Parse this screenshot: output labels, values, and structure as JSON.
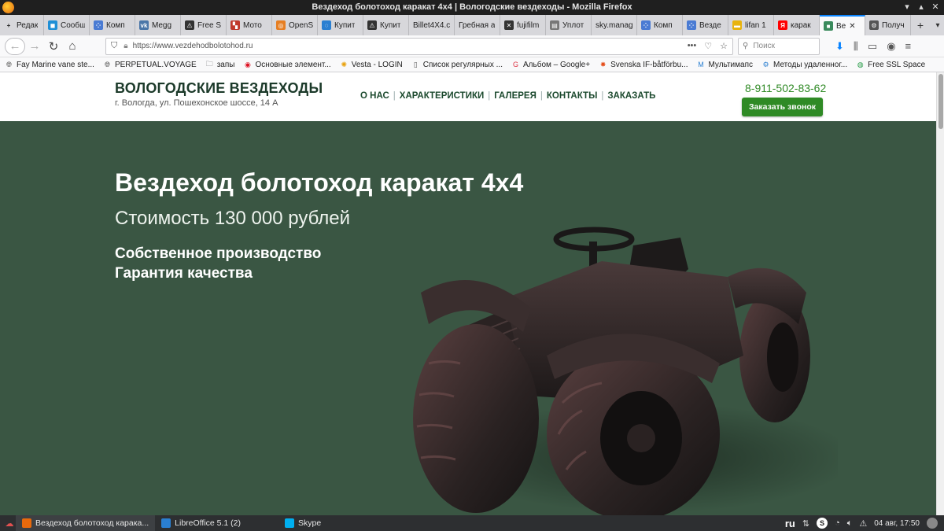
{
  "window": {
    "title": "Вездеход болотоход каракат 4x4 | Вологодские вездеходы - Mozilla Firefox"
  },
  "tabs": [
    {
      "label": "Редак",
      "icon": "plus",
      "color": "#d7d7db"
    },
    {
      "label": "Сообщ",
      "icon": "chat",
      "color": "#1f8fd6"
    },
    {
      "label": "Комп",
      "icon": "dots",
      "color": "#4a7bd3"
    },
    {
      "label": "Megg",
      "icon": "vk",
      "color": "#4a76a8"
    },
    {
      "label": "Free S",
      "icon": "warning",
      "color": "#333333"
    },
    {
      "label": "Мото",
      "icon": "flag",
      "color": "#c0392b"
    },
    {
      "label": "OpenS",
      "icon": "circle",
      "color": "#e67e22"
    },
    {
      "label": "Купит",
      "icon": "swirl",
      "color": "#2a7fd1"
    },
    {
      "label": "Купит",
      "icon": "warning",
      "color": "#333333"
    },
    {
      "label": "Billet4X4.c",
      "icon": "none",
      "color": "#d7d7db"
    },
    {
      "label": "Гребная а",
      "icon": "none",
      "color": "#d7d7db"
    },
    {
      "label": "fujifilm",
      "icon": "x",
      "color": "#333333"
    },
    {
      "label": "Уплот",
      "icon": "doc",
      "color": "#777777"
    },
    {
      "label": "sky.manag",
      "icon": "none",
      "color": "#d7d7db"
    },
    {
      "label": "Комп",
      "icon": "dots",
      "color": "#4a7bd3"
    },
    {
      "label": "Везде",
      "icon": "dots",
      "color": "#4a7bd3"
    },
    {
      "label": "lifan 1",
      "icon": "bars",
      "color": "#e8b30c"
    },
    {
      "label": "карак",
      "icon": "ya",
      "color": "#ff0000"
    },
    {
      "label": "Ве",
      "icon": "square",
      "color": "#3a8a5c",
      "active": true
    },
    {
      "label": "Получ",
      "icon": "gear",
      "color": "#555555"
    }
  ],
  "nav": {
    "url": "https://www.vezdehodbolotohod.ru",
    "search_placeholder": "Поиск"
  },
  "bookmarks": [
    {
      "label": "Fay Marine vane ste...",
      "icon": "globe"
    },
    {
      "label": "PERPETUAL.VOYAGE",
      "icon": "globe"
    },
    {
      "label": "запы",
      "icon": "folder"
    },
    {
      "label": "Основные элемент...",
      "icon": "opera"
    },
    {
      "label": "Vesta - LOGIN",
      "icon": "sun"
    },
    {
      "label": "Список регулярных ...",
      "icon": "doc"
    },
    {
      "label": "Альбом – Google+",
      "icon": "gplus"
    },
    {
      "label": "Svenska IF-båtförbu...",
      "icon": "star"
    },
    {
      "label": "Мультимапс",
      "icon": "map"
    },
    {
      "label": "Методы удаленног...",
      "icon": "gear"
    },
    {
      "label": "Free SSL Space",
      "icon": "ssl"
    }
  ],
  "site": {
    "brand": "ВОЛОГОДСКИЕ ВЕЗДЕХОДЫ",
    "address": "г. Вологда, ул. Пошехонское шоссе, 14 А",
    "menu": [
      "О НАС",
      "ХАРАКТЕРИСТИКИ",
      "ГАЛЕРЕЯ",
      "КОНТАКТЫ",
      "ЗАКАЗАТЬ"
    ],
    "phone": "8-911-502-83-62",
    "callback_label": "Заказать звонок"
  },
  "hero": {
    "title": "Вездеход болотоход каракат 4х4",
    "price": "Стоимость 130 000 рублей",
    "features": [
      "Собственное производство",
      "Гарантия качества"
    ],
    "background_color": "#3a5643"
  },
  "taskbar": {
    "items": [
      {
        "label": "Вездеход болотоход карака...",
        "icon": "firefox",
        "active": true
      },
      {
        "label": "LibreOffice 5.1 (2)",
        "icon": "libreoffice"
      },
      {
        "label": "Skype",
        "icon": "skype"
      }
    ],
    "lang": "ru",
    "clock": "04 авг, 17:50"
  }
}
